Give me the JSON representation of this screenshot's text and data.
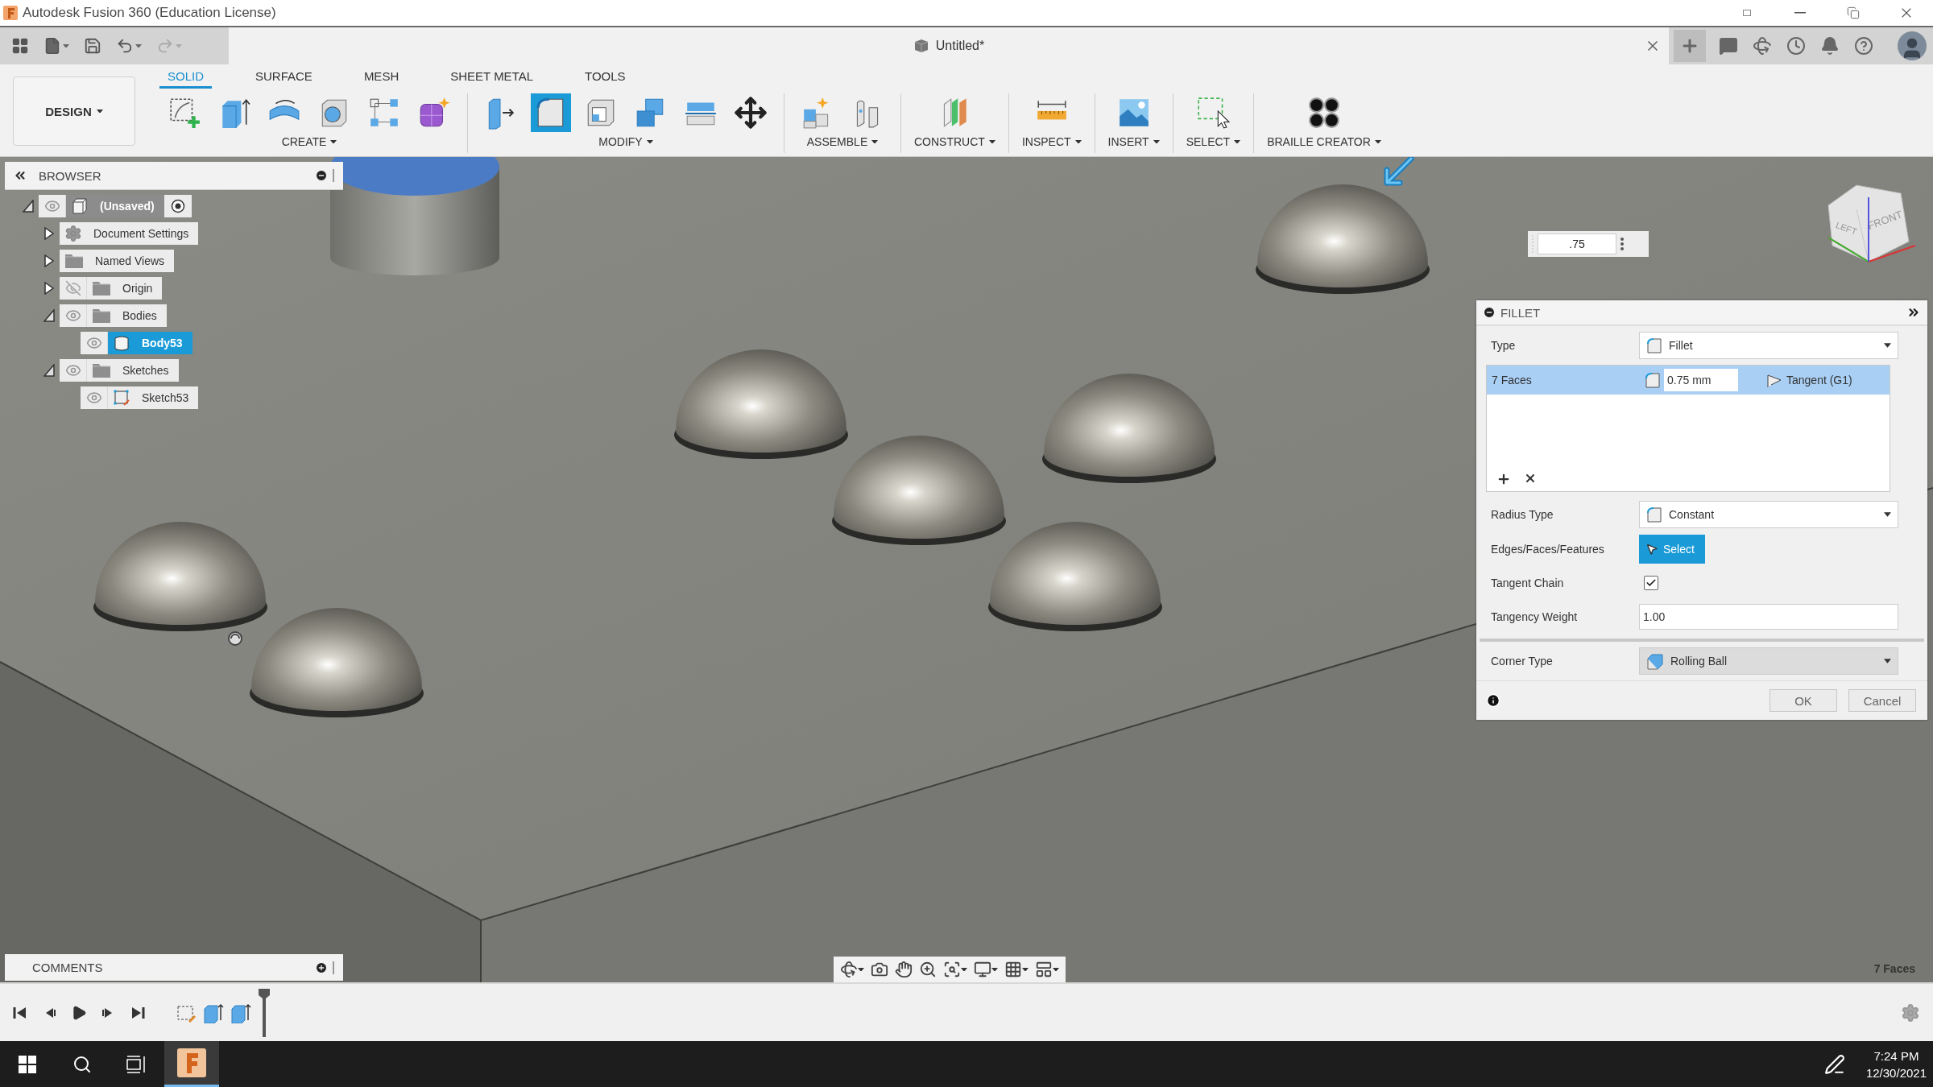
{
  "window": {
    "title": "Autodesk Fusion 360 (Education License)"
  },
  "document_tab": {
    "title": "Untitled*"
  },
  "workspace": {
    "label": "DESIGN"
  },
  "ribbon_tabs": [
    {
      "label": "SOLID",
      "selected": true
    },
    {
      "label": "SURFACE",
      "selected": false
    },
    {
      "label": "MESH",
      "selected": false
    },
    {
      "label": "SHEET METAL",
      "selected": false
    },
    {
      "label": "TOOLS",
      "selected": false
    }
  ],
  "tool_groups": [
    {
      "label": "CREATE",
      "tools": [
        {
          "kind": "sketch",
          "selected": false
        },
        {
          "kind": "extrude",
          "selected": false
        },
        {
          "kind": "revolve",
          "selected": false
        },
        {
          "kind": "hole",
          "selected": false
        },
        {
          "kind": "pattern",
          "selected": false
        },
        {
          "kind": "form",
          "selected": false
        }
      ]
    },
    {
      "label": "MODIFY",
      "tools": [
        {
          "kind": "presspull",
          "selected": false
        },
        {
          "kind": "fillet",
          "selected": true
        },
        {
          "kind": "shell",
          "selected": false
        },
        {
          "kind": "combine",
          "selected": false
        },
        {
          "kind": "split",
          "selected": false
        },
        {
          "kind": "move",
          "selected": false
        }
      ]
    },
    {
      "label": "ASSEMBLE",
      "tools": [
        {
          "kind": "component",
          "selected": false
        },
        {
          "kind": "joint",
          "selected": false
        }
      ]
    },
    {
      "label": "CONSTRUCT",
      "tools": [
        {
          "kind": "plane",
          "selected": false
        }
      ]
    },
    {
      "label": "INSPECT",
      "tools": [
        {
          "kind": "measure",
          "selected": false
        }
      ]
    },
    {
      "label": "INSERT",
      "tools": [
        {
          "kind": "image",
          "selected": false
        }
      ]
    },
    {
      "label": "SELECT",
      "tools": [
        {
          "kind": "select",
          "selected": false
        }
      ]
    },
    {
      "label": "BRAILLE CREATOR",
      "tools": [
        {
          "kind": "braille",
          "selected": false
        }
      ]
    }
  ],
  "browser": {
    "title": "BROWSER",
    "tree": [
      {
        "label": "(Unsaved)",
        "kind": "component",
        "visible": true,
        "expanded": true,
        "selected": false,
        "children": [
          {
            "label": "Document Settings",
            "kind": "settings",
            "expanded": false,
            "selected": false
          },
          {
            "label": "Named Views",
            "kind": "views",
            "expanded": false,
            "selected": false
          },
          {
            "label": "Origin",
            "kind": "folder",
            "visible": false,
            "expanded": false,
            "selected": false
          },
          {
            "label": "Bodies",
            "kind": "folder",
            "visible": true,
            "expanded": true,
            "selected": false,
            "children": [
              {
                "label": "Body53",
                "kind": "body",
                "visible": true,
                "selected": true
              }
            ]
          },
          {
            "label": "Sketches",
            "kind": "folder",
            "visible": true,
            "expanded": true,
            "selected": false,
            "children": [
              {
                "label": "Sketch53",
                "kind": "sketch",
                "visible": true,
                "selected": false
              }
            ]
          }
        ]
      }
    ]
  },
  "dimension_input": {
    "value": ".75"
  },
  "view_cube": {
    "faces": [
      "LEFT",
      "FRONT"
    ]
  },
  "fillet": {
    "title": "FILLET",
    "type": {
      "label": "Type",
      "value": "Fillet"
    },
    "selection_sets": [
      {
        "label": "7 Faces",
        "radius": "0.75 mm",
        "continuity": "Tangent (G1)",
        "selected": true
      }
    ],
    "fields": [
      {
        "kind": "dropdown",
        "label": "Radius Type",
        "value": "Constant"
      },
      {
        "kind": "selector",
        "label": "Edges/Faces/Features",
        "value": "Select",
        "active": true
      },
      {
        "kind": "checkbox",
        "label": "Tangent Chain",
        "checked": true
      },
      {
        "kind": "number",
        "label": "Tangency Weight",
        "value": "1.00"
      }
    ],
    "corner_type": {
      "label": "Corner Type",
      "value": "Rolling Ball"
    },
    "buttons": [
      "OK",
      "Cancel"
    ]
  },
  "comments": {
    "title": "COMMENTS"
  },
  "status": {
    "selection": "7 Faces"
  },
  "timeline": {
    "features": [
      {
        "kind": "sketch"
      },
      {
        "kind": "extrude"
      },
      {
        "kind": "extrude"
      }
    ]
  },
  "taskbar": {
    "app_active": true,
    "time": "7:24 PM",
    "date": "12/30/2021"
  }
}
